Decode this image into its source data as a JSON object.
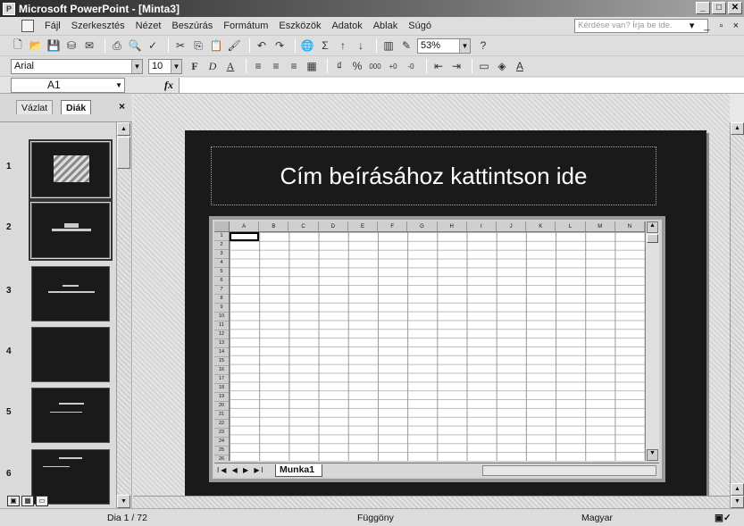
{
  "window": {
    "title": "Microsoft PowerPoint - [Minta3]",
    "buttons": [
      "_",
      "□",
      "✕"
    ]
  },
  "menu": {
    "items": [
      "Fájl",
      "Szerkesztés",
      "Nézet",
      "Beszúrás",
      "Formátum",
      "Eszközök",
      "Adatok",
      "Ablak",
      "Súgó"
    ],
    "help_placeholder": "Kérdése van? Írja be ide.",
    "doc_controls": "▾ _ ▫ ×"
  },
  "toolbar_standard": {
    "zoom": "53%"
  },
  "toolbar_format": {
    "font": "Arial",
    "size": "10"
  },
  "formula_bar": {
    "name_box": "A1",
    "fx": "fx"
  },
  "panel": {
    "tabs": [
      "Vázlat",
      "Diák"
    ],
    "active_tab": "Diák",
    "close": "×",
    "slides": [
      "1",
      "2",
      "3",
      "4",
      "5",
      "6"
    ]
  },
  "slide": {
    "title": "Cím beírásához kattintson ide"
  },
  "excel": {
    "columns": [
      "A",
      "B",
      "C",
      "D",
      "E",
      "F",
      "G",
      "H",
      "I",
      "J",
      "K",
      "L",
      "M",
      "N"
    ],
    "rows": [
      "1",
      "2",
      "3",
      "4",
      "5",
      "6",
      "7",
      "8",
      "9",
      "10",
      "11",
      "12",
      "13",
      "14",
      "15",
      "16",
      "17",
      "18",
      "19",
      "20",
      "21",
      "22",
      "23",
      "24",
      "25",
      "26"
    ],
    "sheet_tab": "Munka1",
    "nav": "I◀ ◀ ▶ ▶I"
  },
  "status": {
    "slide": "Dia 1 / 72",
    "design": "Függöny",
    "language": "Magyar"
  }
}
